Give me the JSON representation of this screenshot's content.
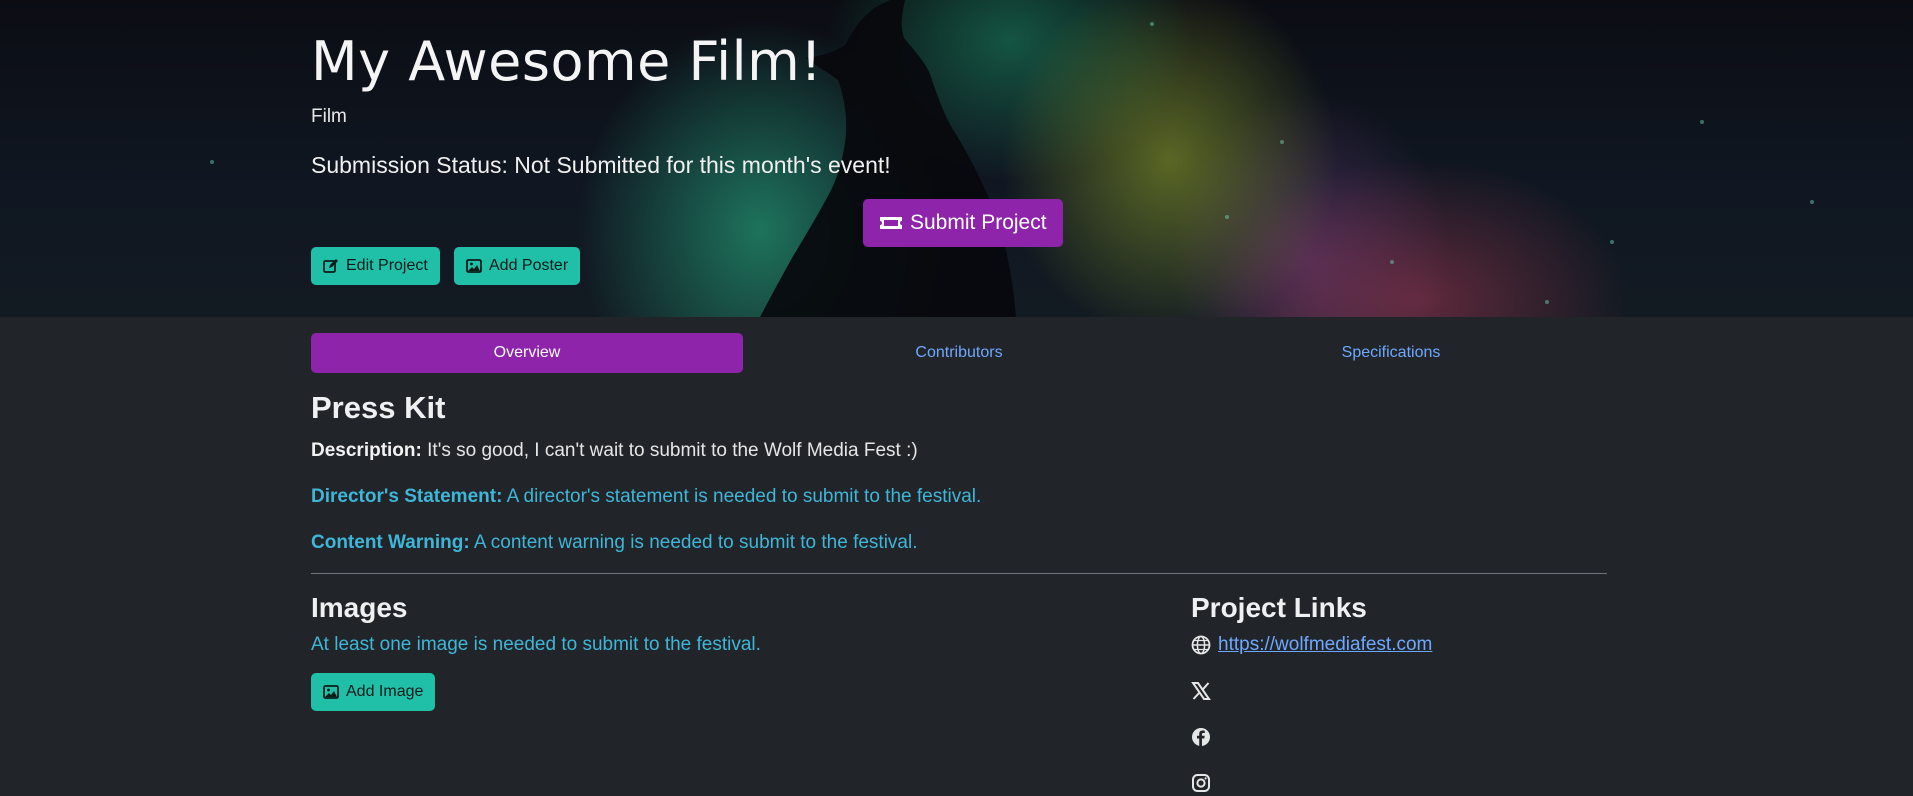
{
  "hero": {
    "title": "My Awesome Film!",
    "type": "Film",
    "status": "Submission Status: Not Submitted for this month's event!",
    "submit_label": "Submit Project",
    "edit_label": "Edit Project",
    "poster_label": "Add Poster"
  },
  "tabs": [
    {
      "label": "Overview",
      "active": true
    },
    {
      "label": "Contributors",
      "active": false
    },
    {
      "label": "Specifications",
      "active": false
    }
  ],
  "press_kit": {
    "heading": "Press Kit",
    "description_label": "Description:",
    "description_value": "It's so good, I can't wait to submit to the Wolf Media Fest :)",
    "directors_label": "Director's Statement:",
    "directors_value": "A director's statement is needed to submit to the festival.",
    "content_warning_label": "Content Warning:",
    "content_warning_value": "A content warning is needed to submit to the festival."
  },
  "images": {
    "heading": "Images",
    "warning": "At least one image is needed to submit to the festival.",
    "add_label": "Add Image"
  },
  "project_links": {
    "heading": "Project Links",
    "website": "https://wolfmediafest.com",
    "icons": [
      "globe-icon",
      "x-icon",
      "facebook-icon",
      "instagram-icon"
    ]
  },
  "colors": {
    "accent_purple": "#8e24aa",
    "teal": "#20c0a8",
    "warning_text": "#3fb6d8",
    "link": "#6ea8fe",
    "background": "#212529"
  }
}
